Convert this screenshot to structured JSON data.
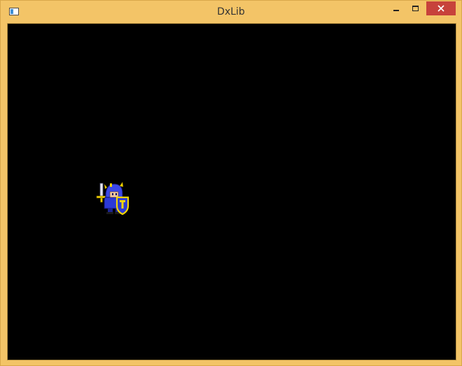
{
  "window": {
    "title": "DxLib",
    "icon": "app-window-icon",
    "frame_color": "#f3c467",
    "close_color": "#c7423b"
  },
  "controls": {
    "minimize_icon": "minimize-icon",
    "maximize_icon": "maximize-icon",
    "close_icon": "close-icon"
  },
  "canvas": {
    "background": "#000000",
    "sprite": "knight-sprite"
  }
}
